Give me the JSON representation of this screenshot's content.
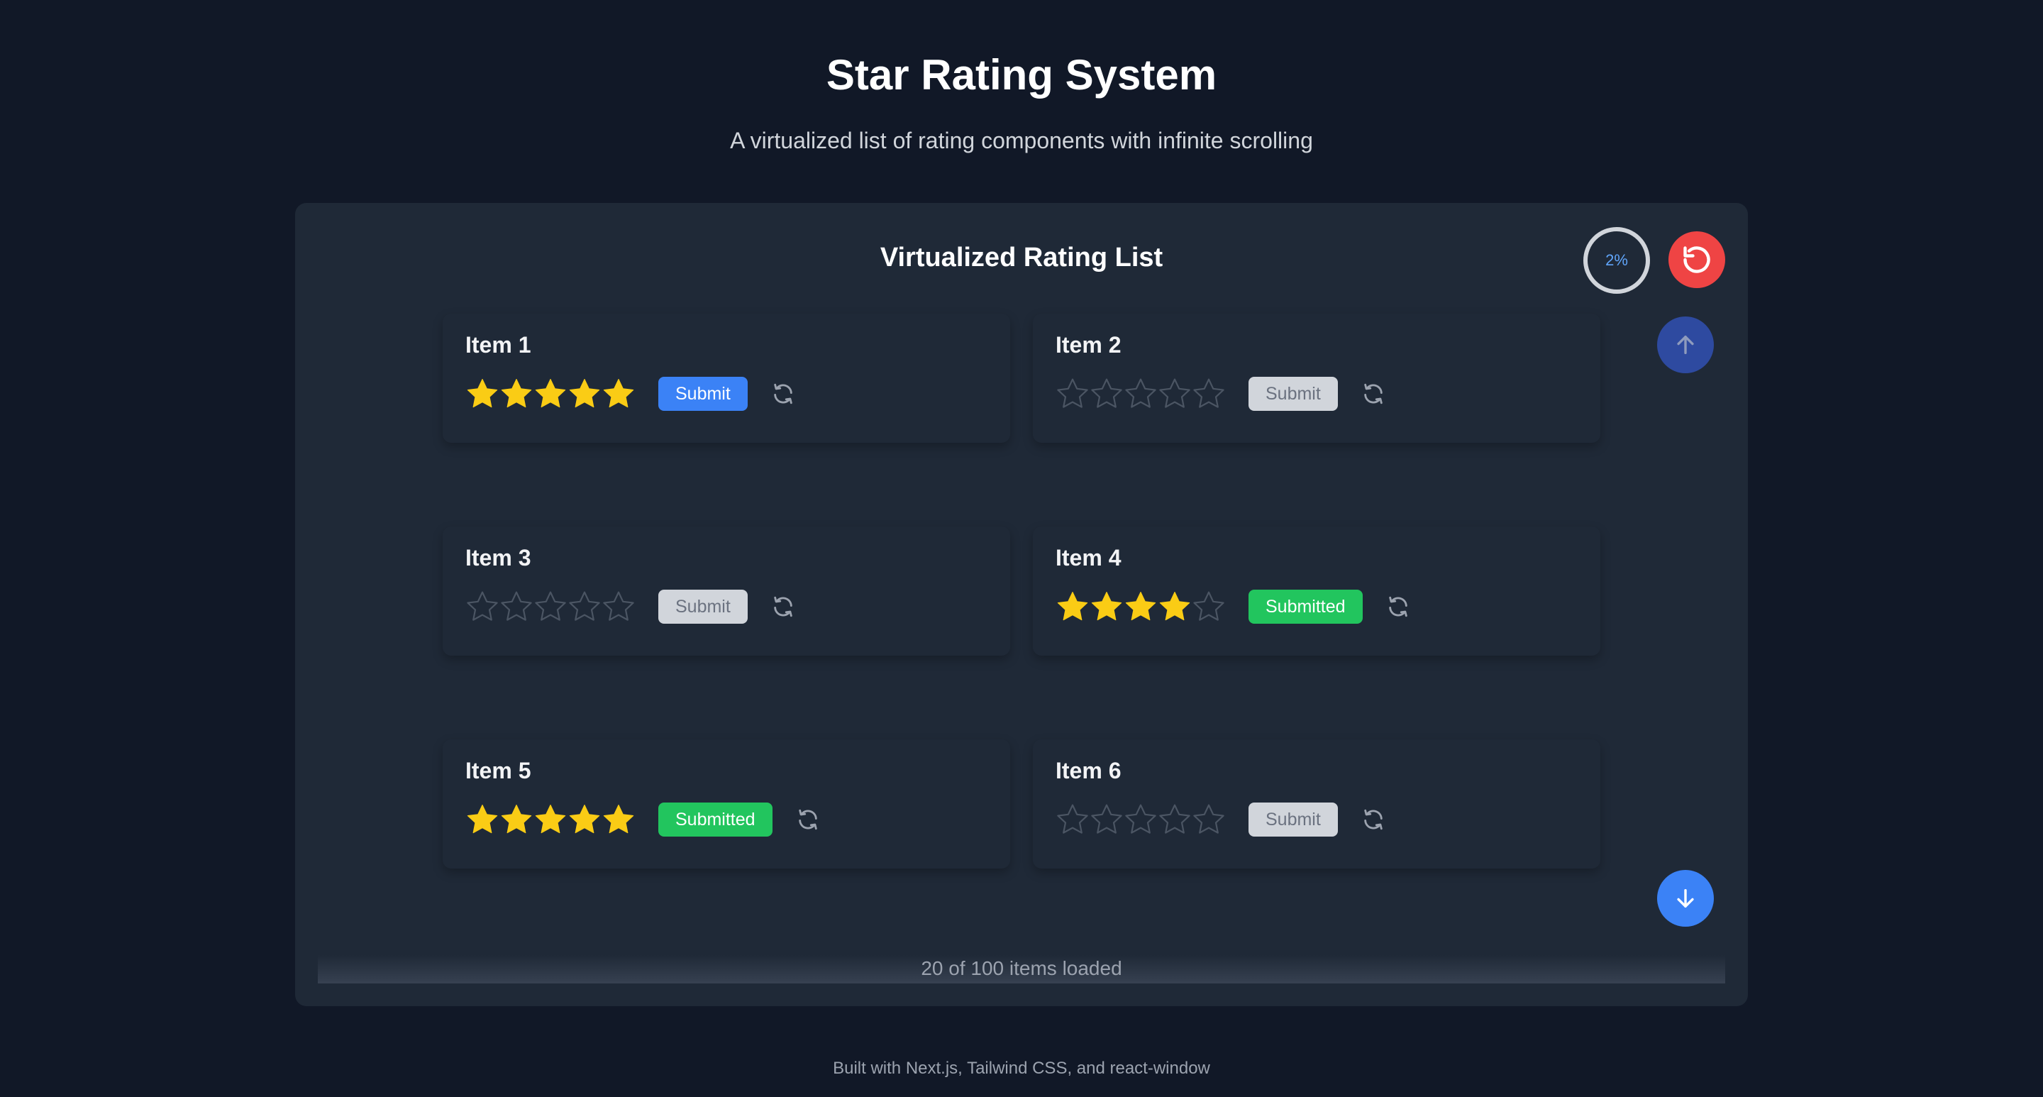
{
  "header": {
    "title": "Star Rating System",
    "subtitle": "A virtualized list of rating components with infinite scrolling"
  },
  "panel": {
    "title": "Virtualized Rating List",
    "progress_label": "2%",
    "progress_value": 0.02,
    "loaded_text": "20 of 100 items loaded"
  },
  "items": [
    {
      "title": "Item 1",
      "rating": 5,
      "button_label": "Submit",
      "button_state": "active"
    },
    {
      "title": "Item 2",
      "rating": 0,
      "button_label": "Submit",
      "button_state": "disabled"
    },
    {
      "title": "Item 3",
      "rating": 0,
      "button_label": "Submit",
      "button_state": "disabled"
    },
    {
      "title": "Item 4",
      "rating": 4,
      "button_label": "Submitted",
      "button_state": "submitted"
    },
    {
      "title": "Item 5",
      "rating": 5,
      "button_label": "Submitted",
      "button_state": "submitted"
    },
    {
      "title": "Item 6",
      "rating": 0,
      "button_label": "Submit",
      "button_state": "disabled"
    }
  ],
  "icons": {
    "reset_all": "reset-icon",
    "scroll_up": "arrow-up-icon",
    "scroll_down": "arrow-down-icon",
    "item_reset": "refresh-icon",
    "star": "star-icon"
  },
  "colors": {
    "background": "#111827",
    "panel": "#1f2937",
    "star_filled": "#facc15",
    "star_empty": "#4b5563",
    "submit": "#3b82f6",
    "submitted": "#22c55e",
    "reset": "#ef4444"
  },
  "footer": {
    "built_with": "Built with Next.js, Tailwind CSS, and react-window"
  }
}
